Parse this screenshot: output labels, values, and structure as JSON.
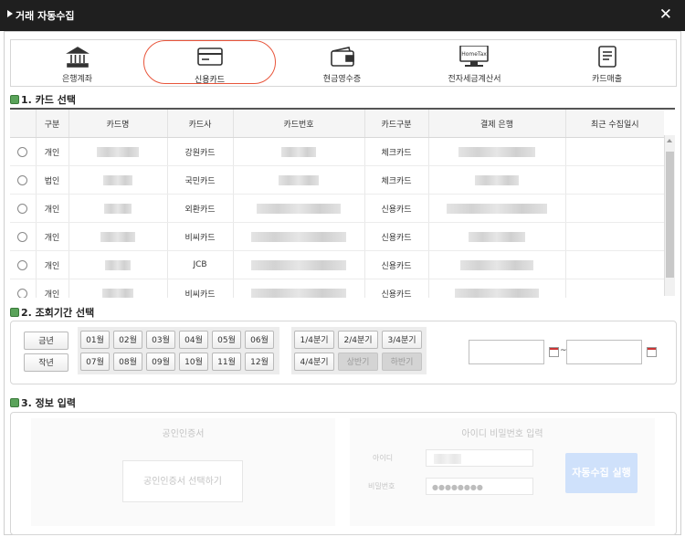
{
  "window": {
    "title": "거래 자동수집"
  },
  "tabs": [
    {
      "label": "은행계좌",
      "icon": "bank-icon"
    },
    {
      "label": "신용카드",
      "icon": "credit-card-icon",
      "active": true
    },
    {
      "label": "현금영수증",
      "icon": "wallet-icon"
    },
    {
      "label": "전자세금계산서",
      "icon": "hometax-icon"
    },
    {
      "label": "카드매출",
      "icon": "document-icon"
    }
  ],
  "hometax_label": "HomeTax",
  "sections": {
    "card": "1. 카드 선택",
    "period": "2. 조회기간 선택",
    "info": "3. 정보 입력"
  },
  "card_table": {
    "headers": [
      "구분",
      "카드명",
      "카드사",
      "카드번호",
      "카드구분",
      "결제 은행",
      "최근 수집일시"
    ],
    "rows": [
      {
        "type": "개인",
        "company": "강원카드",
        "kind": "체크카드"
      },
      {
        "type": "법인",
        "company": "국민카드",
        "kind": "체크카드"
      },
      {
        "type": "개인",
        "company": "외환카드",
        "kind": "신용카드"
      },
      {
        "type": "개인",
        "company": "비씨카드",
        "kind": "신용카드"
      },
      {
        "type": "개인",
        "company": "JCB",
        "kind": "신용카드"
      },
      {
        "type": "개인",
        "company": "비씨카드",
        "kind": "신용카드"
      }
    ]
  },
  "period": {
    "years": [
      "금년",
      "작년"
    ],
    "months_row1": [
      "01월",
      "02월",
      "03월",
      "04월",
      "05월",
      "06월"
    ],
    "months_row2": [
      "07월",
      "08월",
      "09월",
      "10월",
      "11월",
      "12월"
    ],
    "quarters_row1": [
      "1/4분기",
      "2/4분기",
      "3/4분기"
    ],
    "quarters_row2": [
      "4/4분기",
      "상반기",
      "하반기"
    ],
    "tilde": "~"
  },
  "info": {
    "cert_title": "공인인증서",
    "cert_button": "공인인증서 선택하기",
    "idpw_title": "아이디 비밀번호 입력",
    "id_label": "아이디",
    "pw_label": "비밀번호",
    "pw_mask": "●●●●●●●●",
    "run_button": "자동수집 실행"
  },
  "colors": {
    "accent": "#e8553b",
    "titlebar": "#1f1f1f",
    "run_button": "#cfe1fb"
  }
}
